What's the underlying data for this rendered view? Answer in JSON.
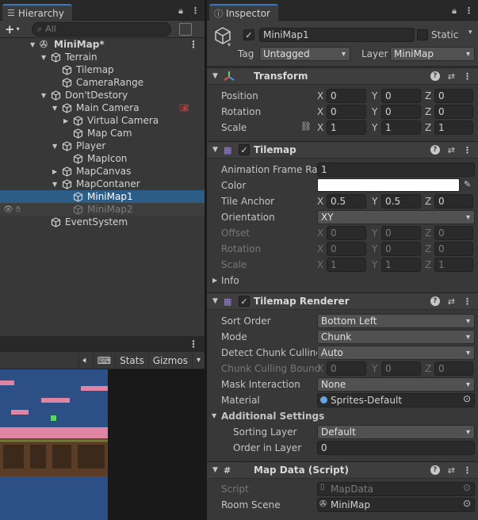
{
  "hierarchy": {
    "tab_label": "Hierarchy",
    "search_placeholder": "All",
    "items": [
      {
        "label": "MiniMap*",
        "indent": 0,
        "arrow": "down",
        "icon": "unity-logo-icon",
        "bold": true,
        "state": "normal"
      },
      {
        "label": "Terrain",
        "indent": 1,
        "arrow": "down",
        "icon": "cube-icon",
        "state": "normal"
      },
      {
        "label": "Tilemap",
        "indent": 2,
        "arrow": "",
        "icon": "cube-icon",
        "state": "normal"
      },
      {
        "label": "CameraRange",
        "indent": 2,
        "arrow": "",
        "icon": "cube-icon",
        "state": "normal"
      },
      {
        "label": "Don'tDestory",
        "indent": 1,
        "arrow": "down",
        "icon": "cube-icon",
        "state": "normal"
      },
      {
        "label": "Main Camera",
        "indent": 2,
        "arrow": "down",
        "icon": "cube-icon",
        "state": "normal"
      },
      {
        "label": "Virtual Camera",
        "indent": 3,
        "arrow": "right",
        "icon": "cube-icon",
        "state": "normal"
      },
      {
        "label": "Map Cam",
        "indent": 3,
        "arrow": "",
        "icon": "cube-icon",
        "state": "normal"
      },
      {
        "label": "Player",
        "indent": 2,
        "arrow": "down",
        "icon": "cube-icon",
        "state": "normal"
      },
      {
        "label": "MapIcon",
        "indent": 3,
        "arrow": "",
        "icon": "cube-icon",
        "state": "normal"
      },
      {
        "label": "MapCanvas",
        "indent": 2,
        "arrow": "right",
        "icon": "cube-icon",
        "state": "normal"
      },
      {
        "label": "MapContaner",
        "indent": 2,
        "arrow": "down",
        "icon": "cube-icon",
        "state": "normal"
      },
      {
        "label": "MiniMap1",
        "indent": 3,
        "arrow": "",
        "icon": "cube-icon",
        "state": "selected"
      },
      {
        "label": "MiniMap2",
        "indent": 3,
        "arrow": "",
        "icon": "cube-icon",
        "state": "disabled"
      },
      {
        "label": "EventSystem",
        "indent": 1,
        "arrow": "",
        "icon": "cube-icon",
        "state": "normal"
      }
    ]
  },
  "game_toolbar": {
    "stats": "Stats",
    "gizmos": "Gizmos"
  },
  "inspector": {
    "tab_label": "Inspector",
    "object_name": "MiniMap1",
    "static_label": "Static",
    "tag_label": "Tag",
    "tag_value": "Untagged",
    "layer_label": "Layer",
    "layer_value": "MiniMap",
    "transform": {
      "title": "Transform",
      "position_label": "Position",
      "rotation_label": "Rotation",
      "scale_label": "Scale",
      "position": [
        "0",
        "0",
        "0"
      ],
      "rotation": [
        "0",
        "0",
        "0"
      ],
      "scale": [
        "1",
        "1",
        "1"
      ]
    },
    "tilemap": {
      "title": "Tilemap",
      "anim_rate_label": "Animation Frame Rate",
      "anim_rate_value": "1",
      "color_label": "Color",
      "tile_anchor_label": "Tile Anchor",
      "tile_anchor": [
        "0.5",
        "0.5",
        "0"
      ],
      "orientation_label": "Orientation",
      "orientation_value": "XY",
      "offset_label": "Offset",
      "offset": [
        "0",
        "0",
        "0"
      ],
      "rotation_label": "Rotation",
      "rotation": [
        "0",
        "0",
        "0"
      ],
      "scale_label": "Scale",
      "scale": [
        "1",
        "1",
        "1"
      ],
      "info_label": "Info"
    },
    "renderer": {
      "title": "Tilemap Renderer",
      "sort_order_label": "Sort Order",
      "sort_order_value": "Bottom Left",
      "mode_label": "Mode",
      "mode_value": "Chunk",
      "detect_label": "Detect Chunk Culling",
      "detect_value": "Auto",
      "bounds_label": "Chunk Culling Bound",
      "bounds": [
        "0",
        "0",
        "0"
      ],
      "mask_label": "Mask Interaction",
      "mask_value": "None",
      "material_label": "Material",
      "material_value": "Sprites-Default",
      "additional_label": "Additional Settings",
      "sorting_layer_label": "Sorting Layer",
      "sorting_layer_value": "Default",
      "order_label": "Order in Layer",
      "order_value": "0"
    },
    "map_data": {
      "title": "Map Data (Script)",
      "script_label": "Script",
      "script_value": "MapData",
      "room_label": "Room Scene",
      "room_value": "MiniMap"
    }
  },
  "axis": {
    "x": "X",
    "y": "Y",
    "z": "Z"
  },
  "colors": {
    "selection": "#2c5d87",
    "tab_accent": "#3a79bb",
    "map_bg": "#2c4f86",
    "pink": "#e084a3",
    "green": "#5bd56a"
  }
}
